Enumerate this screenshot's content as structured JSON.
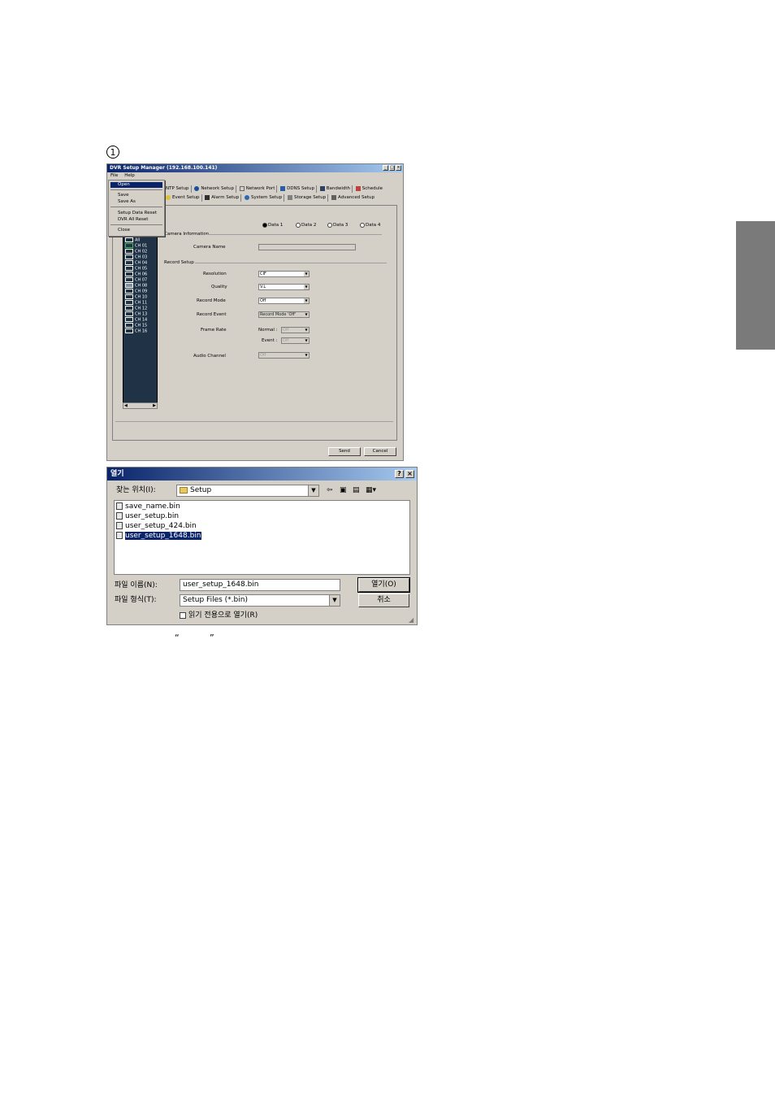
{
  "step_marker": "1",
  "dvr_window": {
    "title": "DVR Setup Manager (192.168.100.141)",
    "menu": [
      "File",
      "Help"
    ],
    "file_menu": {
      "items": [
        "Open",
        "Save",
        "Save As",
        "Setup Data Reset",
        "DVR All Reset",
        "Close"
      ],
      "active": "Open"
    },
    "tabs_row1": [
      "NTP Setup",
      "Network Setup",
      "Network Port",
      "DDNS Setup",
      "Bandwidth",
      "Schedule"
    ],
    "tabs_row2": [
      "Event Setup",
      "Alarm Setup",
      "System Setup",
      "Storage Setup",
      "Advanced Setup"
    ],
    "data_options": [
      "Data 1",
      "Data 2",
      "Data 3",
      "Data 4"
    ],
    "data_selected": "Data 1",
    "channels": [
      "All",
      "CH 01",
      "CH 02",
      "CH 03",
      "CH 04",
      "CH 05",
      "CH 06",
      "CH 07",
      "CH 08",
      "CH 09",
      "CH 10",
      "CH 11",
      "CH 12",
      "CH 13",
      "CH 14",
      "CH 15",
      "CH 16"
    ],
    "camera_information": {
      "section_label": "Camera Information",
      "camera_name_label": "Camera Name",
      "camera_name_value": ""
    },
    "record_setup": {
      "section_label": "Record Setup",
      "resolution_label": "Resolution",
      "resolution_value": "CIF",
      "quality_label": "Quality",
      "quality_value": "V.L",
      "record_mode_label": "Record Mode",
      "record_mode_value": "Off",
      "record_event_label": "Record Event",
      "record_event_value": "Record Mode 'Off'",
      "frame_rate_label": "Frame Rate",
      "normal_label": "Normal :",
      "normal_value": "Off",
      "event_label": "Event :",
      "event_value": "Off",
      "audio_channel_label": "Audio Channel",
      "audio_channel_value": "Off"
    },
    "send_label": "Send",
    "cancel_label": "Cancel"
  },
  "open_dialog": {
    "title": "열기",
    "look_in_label": "찾는 위치(I):",
    "look_in_value": "Setup",
    "files": [
      "save_name.bin",
      "user_setup.bin",
      "user_setup_424.bin",
      "user_setup_1648.bin"
    ],
    "selected_file": "user_setup_1648.bin",
    "file_name_label": "파일 이름(N):",
    "file_name_value": "user_setup_1648.bin",
    "file_type_label": "파일 형식(T):",
    "file_type_value": "Setup Files (*.bin)",
    "readonly_label": "읽기 전용으로 열기(R)",
    "open_button": "열기(O)",
    "cancel_button": "취소"
  },
  "caption_quotes": {
    "open": "“",
    "close": "”"
  },
  "colors": {
    "titlebar": "#0a246a",
    "window_face": "#d4d0c8",
    "channel_list_bg": "#1f3246",
    "side_tab": "#7a7a7a",
    "selection": "#0a246a"
  }
}
